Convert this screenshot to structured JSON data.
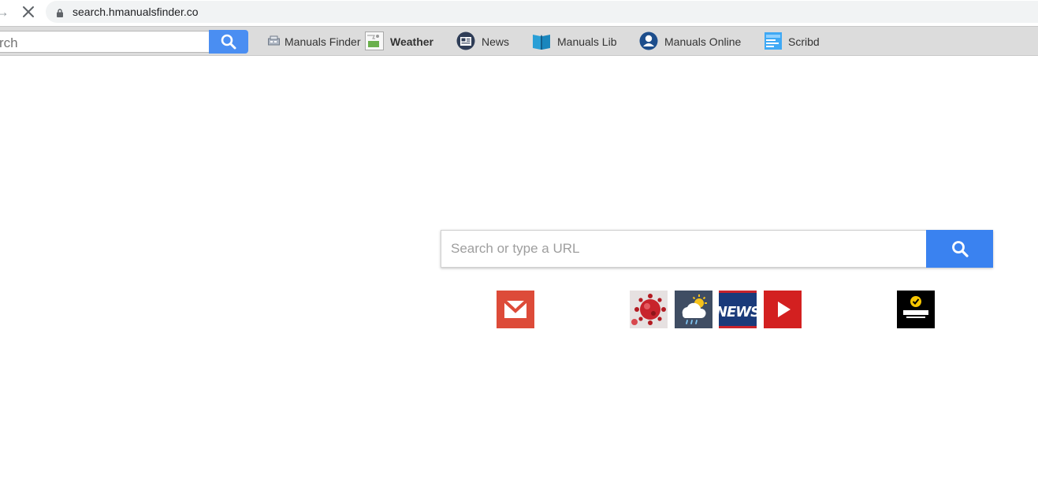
{
  "browser": {
    "url": "search.hmanualsfinder.co",
    "forward_icon": "arrow-right-icon",
    "stop_icon": "close-icon",
    "lock_icon": "lock-icon"
  },
  "toolbar": {
    "search_placeholder": "rch",
    "search_button_icon": "search-icon",
    "links": [
      {
        "label": "Manuals Finder",
        "icon": "manuals-finder-icon"
      },
      {
        "label": "Weather",
        "icon": "broken-image-icon"
      },
      {
        "label": "News",
        "icon": "newspaper-icon"
      },
      {
        "label": "Manuals Lib",
        "icon": "book-icon"
      },
      {
        "label": "Manuals Online",
        "icon": "user-circle-icon"
      },
      {
        "label": "Scribd",
        "icon": "scribd-icon"
      }
    ]
  },
  "main_search": {
    "placeholder": "Search or type a URL",
    "button_icon": "search-icon"
  },
  "tiles": [
    {
      "name": "Gmail",
      "icon": "gmail-icon",
      "color": "#dd4b39"
    },
    {
      "name": "Covid",
      "icon": "virus-icon",
      "color": "#c8232c"
    },
    {
      "name": "Weather",
      "icon": "weather-icon",
      "color": "#3f4d63"
    },
    {
      "name": "News",
      "icon": "news-icon",
      "color": "#1a3a7a"
    },
    {
      "name": "YouTube",
      "icon": "play-icon",
      "color": "#d32020"
    },
    {
      "name": "Norton",
      "icon": "norton-icon",
      "color": "#000000"
    }
  ],
  "colors": {
    "accent": "#3a82f0",
    "toolbar_bg": "#dcdcdc"
  }
}
